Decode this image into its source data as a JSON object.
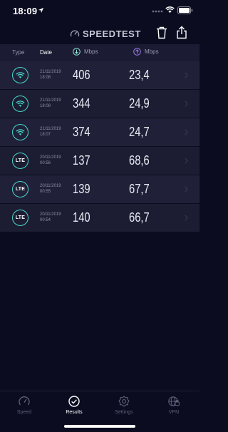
{
  "status_bar": {
    "time": "18:09"
  },
  "app": {
    "brand": "SPEEDTEST"
  },
  "table": {
    "headers": {
      "type": "Type",
      "date": "Date",
      "download": "Mbps",
      "upload": "Mbps"
    },
    "rows": [
      {
        "type": "wifi",
        "date": "21/11/2019",
        "time": "18:08",
        "download": "406",
        "upload": "23,4"
      },
      {
        "type": "wifi",
        "date": "21/11/2019",
        "time": "18:08",
        "download": "344",
        "upload": "24,9"
      },
      {
        "type": "wifi",
        "date": "21/11/2019",
        "time": "18:07",
        "download": "374",
        "upload": "24,7"
      },
      {
        "type": "LTE",
        "date": "20/11/2019",
        "time": "00:56",
        "download": "137",
        "upload": "68,6"
      },
      {
        "type": "LTE",
        "date": "20/11/2019",
        "time": "00:55",
        "download": "139",
        "upload": "67,7"
      },
      {
        "type": "LTE",
        "date": "20/11/2019",
        "time": "00:54",
        "download": "140",
        "upload": "66,7"
      }
    ]
  },
  "tabs": [
    {
      "label": "Speed",
      "icon": "speedometer-icon",
      "active": false
    },
    {
      "label": "Results",
      "icon": "check-circle-icon",
      "active": true
    },
    {
      "label": "Settings",
      "icon": "gear-icon",
      "active": false
    },
    {
      "label": "VPN",
      "icon": "globe-lock-icon",
      "active": false
    }
  ],
  "colors": {
    "background": "#0b0c20",
    "accent_teal": "#4ad5c8",
    "download_accent": "#8fe3d8",
    "upload_accent": "#a07be8"
  }
}
